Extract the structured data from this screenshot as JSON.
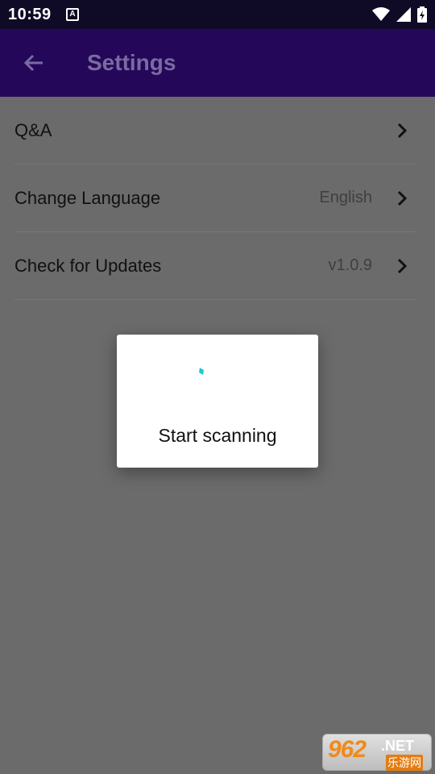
{
  "status_bar": {
    "time": "10:59",
    "notification_badge": "A",
    "icons": [
      "wifi-icon",
      "signal-icon",
      "battery-icon"
    ]
  },
  "app_bar": {
    "back_icon": "arrow-left-icon",
    "title": "Settings",
    "background_color": "#25075a"
  },
  "settings": {
    "items": [
      {
        "label": "Q&A",
        "value": "",
        "icon": "chevron-right-icon"
      },
      {
        "label": "Change Language",
        "value": "English",
        "icon": "chevron-right-icon"
      },
      {
        "label": "Check for Updates",
        "value": "v1.0.9",
        "icon": "chevron-right-icon"
      }
    ]
  },
  "dialog": {
    "message": "Start scanning",
    "spinner_color": "#1ec9c9"
  },
  "watermark": {
    "number": "962",
    "suffix": ".NET",
    "chinese": "乐游网"
  }
}
